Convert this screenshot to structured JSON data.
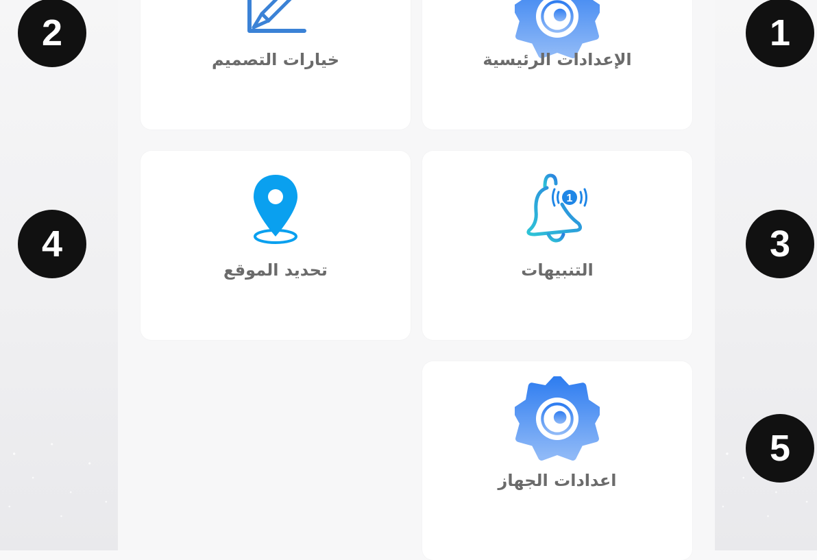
{
  "cards": [
    {
      "id": "main-settings",
      "label": "الإعدادات الرئيسية",
      "icon": "gear-icon"
    },
    {
      "id": "design-options",
      "label": "خيارات التصميم",
      "icon": "pencil-edit-icon"
    },
    {
      "id": "notifications",
      "label": "التنبيهات",
      "icon": "bell-icon",
      "badge": "1"
    },
    {
      "id": "location",
      "label": "تحديد الموقع",
      "icon": "location-pin-icon"
    },
    {
      "id": "device-settings",
      "label": "اعدادات الجهاز",
      "icon": "gear-icon"
    }
  ],
  "callouts": [
    "1",
    "2",
    "3",
    "4",
    "5"
  ],
  "colors": {
    "gear_top": "#2f7df0",
    "gear_bottom": "#8fb9f7",
    "pencil": "#3b82d6",
    "bell_start": "#2ec4d6",
    "bell_end": "#2a7fe0",
    "pin": "#0aa0ef",
    "badge_bg": "#111111"
  }
}
